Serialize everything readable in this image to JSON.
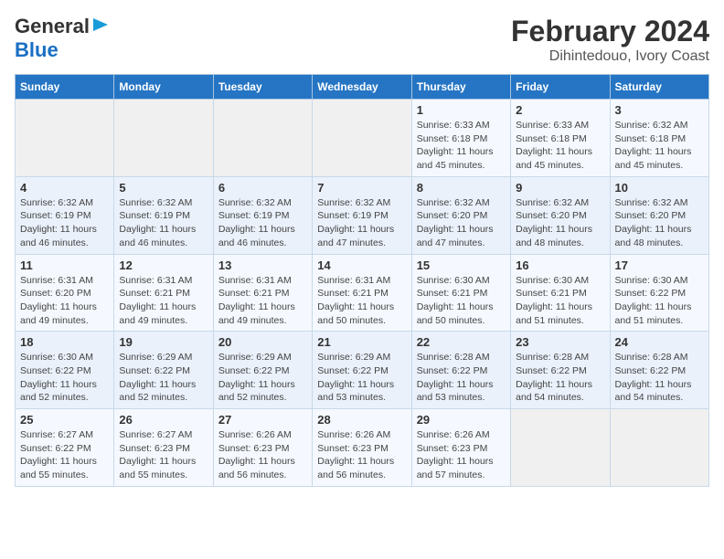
{
  "header": {
    "logo_line1": "General",
    "logo_line2": "Blue",
    "title": "February 2024",
    "subtitle": "Dihintedouo, Ivory Coast"
  },
  "weekdays": [
    "Sunday",
    "Monday",
    "Tuesday",
    "Wednesday",
    "Thursday",
    "Friday",
    "Saturday"
  ],
  "weeks": [
    [
      {
        "day": "",
        "info": ""
      },
      {
        "day": "",
        "info": ""
      },
      {
        "day": "",
        "info": ""
      },
      {
        "day": "",
        "info": ""
      },
      {
        "day": "1",
        "info": "Sunrise: 6:33 AM\nSunset: 6:18 PM\nDaylight: 11 hours and 45 minutes."
      },
      {
        "day": "2",
        "info": "Sunrise: 6:33 AM\nSunset: 6:18 PM\nDaylight: 11 hours and 45 minutes."
      },
      {
        "day": "3",
        "info": "Sunrise: 6:32 AM\nSunset: 6:18 PM\nDaylight: 11 hours and 45 minutes."
      }
    ],
    [
      {
        "day": "4",
        "info": "Sunrise: 6:32 AM\nSunset: 6:19 PM\nDaylight: 11 hours and 46 minutes."
      },
      {
        "day": "5",
        "info": "Sunrise: 6:32 AM\nSunset: 6:19 PM\nDaylight: 11 hours and 46 minutes."
      },
      {
        "day": "6",
        "info": "Sunrise: 6:32 AM\nSunset: 6:19 PM\nDaylight: 11 hours and 46 minutes."
      },
      {
        "day": "7",
        "info": "Sunrise: 6:32 AM\nSunset: 6:19 PM\nDaylight: 11 hours and 47 minutes."
      },
      {
        "day": "8",
        "info": "Sunrise: 6:32 AM\nSunset: 6:20 PM\nDaylight: 11 hours and 47 minutes."
      },
      {
        "day": "9",
        "info": "Sunrise: 6:32 AM\nSunset: 6:20 PM\nDaylight: 11 hours and 48 minutes."
      },
      {
        "day": "10",
        "info": "Sunrise: 6:32 AM\nSunset: 6:20 PM\nDaylight: 11 hours and 48 minutes."
      }
    ],
    [
      {
        "day": "11",
        "info": "Sunrise: 6:31 AM\nSunset: 6:20 PM\nDaylight: 11 hours and 49 minutes."
      },
      {
        "day": "12",
        "info": "Sunrise: 6:31 AM\nSunset: 6:21 PM\nDaylight: 11 hours and 49 minutes."
      },
      {
        "day": "13",
        "info": "Sunrise: 6:31 AM\nSunset: 6:21 PM\nDaylight: 11 hours and 49 minutes."
      },
      {
        "day": "14",
        "info": "Sunrise: 6:31 AM\nSunset: 6:21 PM\nDaylight: 11 hours and 50 minutes."
      },
      {
        "day": "15",
        "info": "Sunrise: 6:30 AM\nSunset: 6:21 PM\nDaylight: 11 hours and 50 minutes."
      },
      {
        "day": "16",
        "info": "Sunrise: 6:30 AM\nSunset: 6:21 PM\nDaylight: 11 hours and 51 minutes."
      },
      {
        "day": "17",
        "info": "Sunrise: 6:30 AM\nSunset: 6:22 PM\nDaylight: 11 hours and 51 minutes."
      }
    ],
    [
      {
        "day": "18",
        "info": "Sunrise: 6:30 AM\nSunset: 6:22 PM\nDaylight: 11 hours and 52 minutes."
      },
      {
        "day": "19",
        "info": "Sunrise: 6:29 AM\nSunset: 6:22 PM\nDaylight: 11 hours and 52 minutes."
      },
      {
        "day": "20",
        "info": "Sunrise: 6:29 AM\nSunset: 6:22 PM\nDaylight: 11 hours and 52 minutes."
      },
      {
        "day": "21",
        "info": "Sunrise: 6:29 AM\nSunset: 6:22 PM\nDaylight: 11 hours and 53 minutes."
      },
      {
        "day": "22",
        "info": "Sunrise: 6:28 AM\nSunset: 6:22 PM\nDaylight: 11 hours and 53 minutes."
      },
      {
        "day": "23",
        "info": "Sunrise: 6:28 AM\nSunset: 6:22 PM\nDaylight: 11 hours and 54 minutes."
      },
      {
        "day": "24",
        "info": "Sunrise: 6:28 AM\nSunset: 6:22 PM\nDaylight: 11 hours and 54 minutes."
      }
    ],
    [
      {
        "day": "25",
        "info": "Sunrise: 6:27 AM\nSunset: 6:22 PM\nDaylight: 11 hours and 55 minutes."
      },
      {
        "day": "26",
        "info": "Sunrise: 6:27 AM\nSunset: 6:23 PM\nDaylight: 11 hours and 55 minutes."
      },
      {
        "day": "27",
        "info": "Sunrise: 6:26 AM\nSunset: 6:23 PM\nDaylight: 11 hours and 56 minutes."
      },
      {
        "day": "28",
        "info": "Sunrise: 6:26 AM\nSunset: 6:23 PM\nDaylight: 11 hours and 56 minutes."
      },
      {
        "day": "29",
        "info": "Sunrise: 6:26 AM\nSunset: 6:23 PM\nDaylight: 11 hours and 57 minutes."
      },
      {
        "day": "",
        "info": ""
      },
      {
        "day": "",
        "info": ""
      }
    ]
  ]
}
